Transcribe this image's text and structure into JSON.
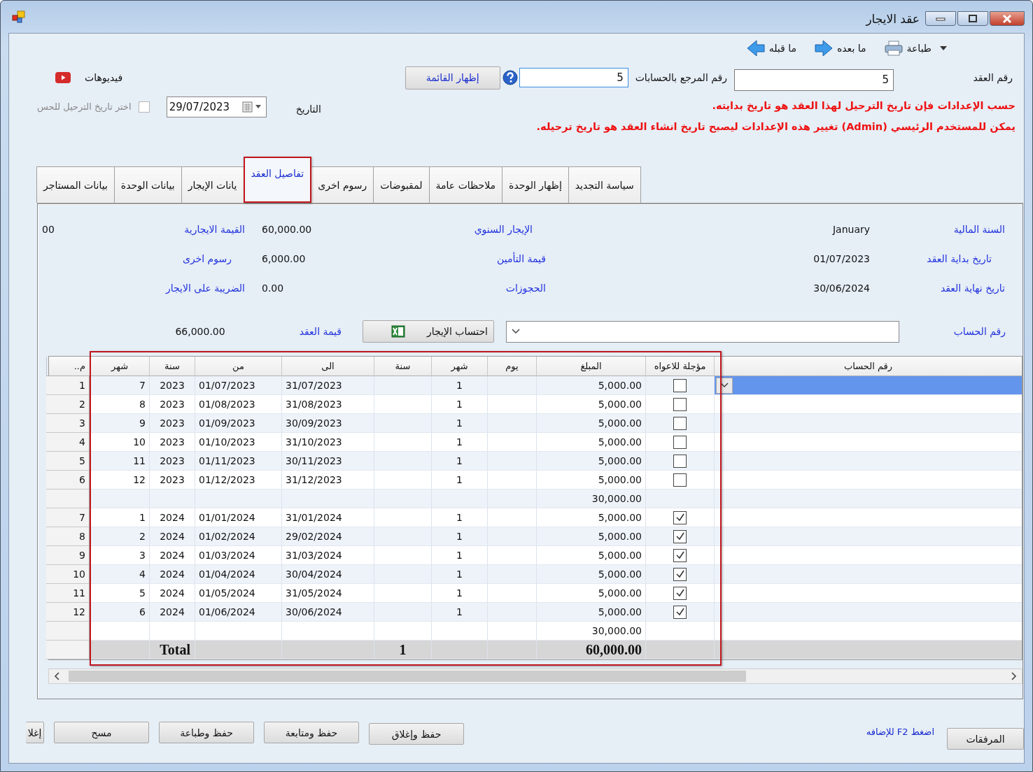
{
  "window": {
    "title": "عقد الايجار"
  },
  "toolbar": [
    {
      "kind": "print",
      "label": "طباعة"
    },
    {
      "kind": "next",
      "label": "ما بعده"
    },
    {
      "kind": "prev",
      "label": "ما قبله"
    }
  ],
  "header": {
    "contract_label": "رقم العقد",
    "contract_no": "5",
    "ref_label": "رقم المرجع بالحسابات",
    "ref_no": "5",
    "list_button": "إظهار القائمة",
    "videos_label": "فيديوهات"
  },
  "date_row": {
    "label": "التاريخ",
    "date": "29/07/2023",
    "posting": {
      "label": "اختر تاريخ الترحيل للحس",
      "checked": false,
      "disabled": true
    }
  },
  "notes": [
    "حسب الإعدادات فإن تاريخ الترحيل لهذا العقد هو تاريخ بدايته.",
    "يمكن للمستخدم الرئيسي (Admin) تغيير هذه الإعدادات ليصبح تاريخ انشاء العقد هو تاريخ ترحيله."
  ],
  "tabs": [
    {
      "label": "سياسة التجديد",
      "selected": false
    },
    {
      "label": "إظهار الوحدة",
      "selected": false
    },
    {
      "label": "ملاحظات عامة",
      "selected": false
    },
    {
      "label": "لمقبوضات",
      "selected": false
    },
    {
      "label": "رسوم اخرى",
      "selected": false
    },
    {
      "label": "تفاصيل العقد",
      "selected": true
    },
    {
      "label": "يانات الإيجار",
      "selected": false
    },
    {
      "label": "بيانات الوحدة",
      "selected": false
    },
    {
      "label": "بيانات المستاجر",
      "selected": false
    }
  ],
  "info_rows": [
    [
      {
        "label": "السنة المالية",
        "value": "January"
      },
      {
        "label": "الإيجار السنوي",
        "value": "60,000.00"
      },
      {
        "label": "القيمة الايجارية",
        "value": "00"
      }
    ],
    [
      {
        "label": "تاريخ بداية العقد",
        "value": "01/07/2023"
      },
      {
        "label": "قيمة التأمين",
        "value": "6,000.00"
      },
      {
        "label": "رسوم اخرى"
      }
    ],
    [
      {
        "label": "تاريخ نهاية العقد",
        "value": "30/06/2024"
      },
      {
        "label": "الحجوزات",
        "value": "0.00"
      },
      {
        "label": "الضريبة على الايجار"
      }
    ]
  ],
  "account_row": {
    "label": "رقم الحساب",
    "calc_button": "احتساب الإيجار",
    "value_label": "قيمة العقد",
    "value": "66,000.00"
  },
  "table": {
    "columns": [
      "رقم الحساب",
      "مؤجلة للاعواه",
      "المبلغ",
      "يوم",
      "شهر",
      "سنة",
      "الى",
      "من",
      "سنة",
      "شهر",
      "م.."
    ],
    "rows": [
      {
        "kind": "item",
        "selected": true,
        "no": "1",
        "month": "7",
        "year": "2023",
        "from": "01/07/2023",
        "to": "31/07/2023",
        "months": "1",
        "amount": "5,000.00",
        "deferred": false
      },
      {
        "kind": "item",
        "selected": false,
        "no": "2",
        "month": "8",
        "year": "2023",
        "from": "01/08/2023",
        "to": "31/08/2023",
        "months": "1",
        "amount": "5,000.00",
        "deferred": false
      },
      {
        "kind": "item",
        "selected": false,
        "no": "3",
        "month": "9",
        "year": "2023",
        "from": "01/09/2023",
        "to": "30/09/2023",
        "months": "1",
        "amount": "5,000.00",
        "deferred": false
      },
      {
        "kind": "item",
        "selected": false,
        "no": "4",
        "month": "10",
        "year": "2023",
        "from": "01/10/2023",
        "to": "31/10/2023",
        "months": "1",
        "amount": "5,000.00",
        "deferred": false
      },
      {
        "kind": "item",
        "selected": false,
        "no": "5",
        "month": "11",
        "year": "2023",
        "from": "01/11/2023",
        "to": "30/11/2023",
        "months": "1",
        "amount": "5,000.00",
        "deferred": false
      },
      {
        "kind": "item",
        "selected": false,
        "no": "6",
        "month": "12",
        "year": "2023",
        "from": "01/12/2023",
        "to": "31/12/2023",
        "months": "1",
        "amount": "5,000.00",
        "deferred": false
      },
      {
        "kind": "subtotal",
        "selected": false,
        "amount": "30,000.00"
      },
      {
        "kind": "item",
        "selected": false,
        "no": "7",
        "month": "1",
        "year": "2024",
        "from": "01/01/2024",
        "to": "31/01/2024",
        "months": "1",
        "amount": "5,000.00",
        "deferred": true
      },
      {
        "kind": "item",
        "selected": false,
        "no": "8",
        "month": "2",
        "year": "2024",
        "from": "01/02/2024",
        "to": "29/02/2024",
        "months": "1",
        "amount": "5,000.00",
        "deferred": true
      },
      {
        "kind": "item",
        "selected": false,
        "no": "9",
        "month": "3",
        "year": "2024",
        "from": "01/03/2024",
        "to": "31/03/2024",
        "months": "1",
        "amount": "5,000.00",
        "deferred": true
      },
      {
        "kind": "item",
        "selected": false,
        "no": "10",
        "month": "4",
        "year": "2024",
        "from": "01/04/2024",
        "to": "30/04/2024",
        "months": "1",
        "amount": "5,000.00",
        "deferred": true
      },
      {
        "kind": "item",
        "selected": false,
        "no": "11",
        "month": "5",
        "year": "2024",
        "from": "01/05/2024",
        "to": "31/05/2024",
        "months": "1",
        "amount": "5,000.00",
        "deferred": true
      },
      {
        "kind": "item",
        "selected": false,
        "no": "12",
        "month": "6",
        "year": "2024",
        "from": "01/06/2024",
        "to": "30/06/2024",
        "months": "1",
        "amount": "5,000.00",
        "deferred": true
      },
      {
        "kind": "subtotal",
        "selected": false,
        "amount": "30,000.00"
      },
      {
        "kind": "total",
        "selected": false,
        "year": "Total",
        "years": "1",
        "amount": "60,000.00"
      }
    ]
  },
  "footer": {
    "attachments_button": "المرفقات",
    "add_hint": "اضغط F2 للإضافه",
    "buttons": [
      "حفظ وإغلاق",
      "حفظ ومتابعة",
      "حفظ وطباعة",
      "مسح",
      "إغلا"
    ]
  }
}
